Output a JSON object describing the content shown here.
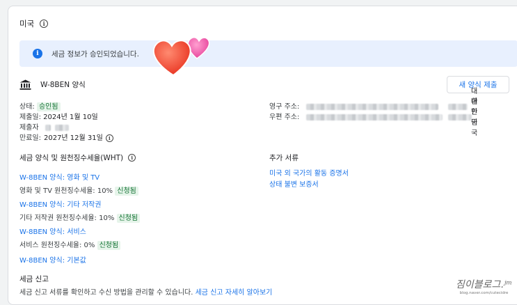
{
  "country": {
    "label": "미국"
  },
  "banner": {
    "text": "세금 정보가 승인되었습니다."
  },
  "form": {
    "name": "W-8BEN 양식",
    "new_button": "새 양식 제출"
  },
  "details": {
    "status_label": "상태:",
    "status_value": "승인됨",
    "submitted_label": "제출일:",
    "submitted_value": "2024년 1월 10일",
    "submitter_label": "제출자",
    "expires_label": "만료일:",
    "expires_value": "2027년 12월 31일"
  },
  "address": {
    "permanent_label": "영구 주소:",
    "postal_label": "우편 주소:",
    "country_value": "대한민국"
  },
  "wht": {
    "heading": "세금 양식 및 원천징수세율(WHT)",
    "film_link": "W-8BEN 양식: 영화 및 TV",
    "film_rate": "영화 및 TV 원천징수세율: 10%",
    "other_link": "W-8BEN 양식: 기타 저작권",
    "other_rate": "기타 저작권 원천징수세율: 10%",
    "services_link": "W-8BEN 양식: 서비스",
    "services_rate": "서비스 원천징수세율: 0%",
    "claimed_badge": "신청됨",
    "default_link": "W-8BEN 양식: 기본값"
  },
  "docs": {
    "heading": "추가 서류",
    "activity_link": "미국 외 국가의 활동 증명서",
    "indemnity_link": "상태 불변 보증서"
  },
  "tax_filing": {
    "heading": "세금 신고",
    "description": "세금 신고 서류를 확인하고 수신 방법을 관리할 수 있습니다.",
    "learn_more_link": "세금 신고 자세히 알아보기"
  },
  "watermark": {
    "main": "짐이블로그.ʲᵐ",
    "sub": "blog.naver.com/cutecidre"
  },
  "colors": {
    "accent": "#1a73e8",
    "banner_bg": "#e8f0fe",
    "badge_bg": "#e6f4ea",
    "badge_text": "#137333"
  }
}
